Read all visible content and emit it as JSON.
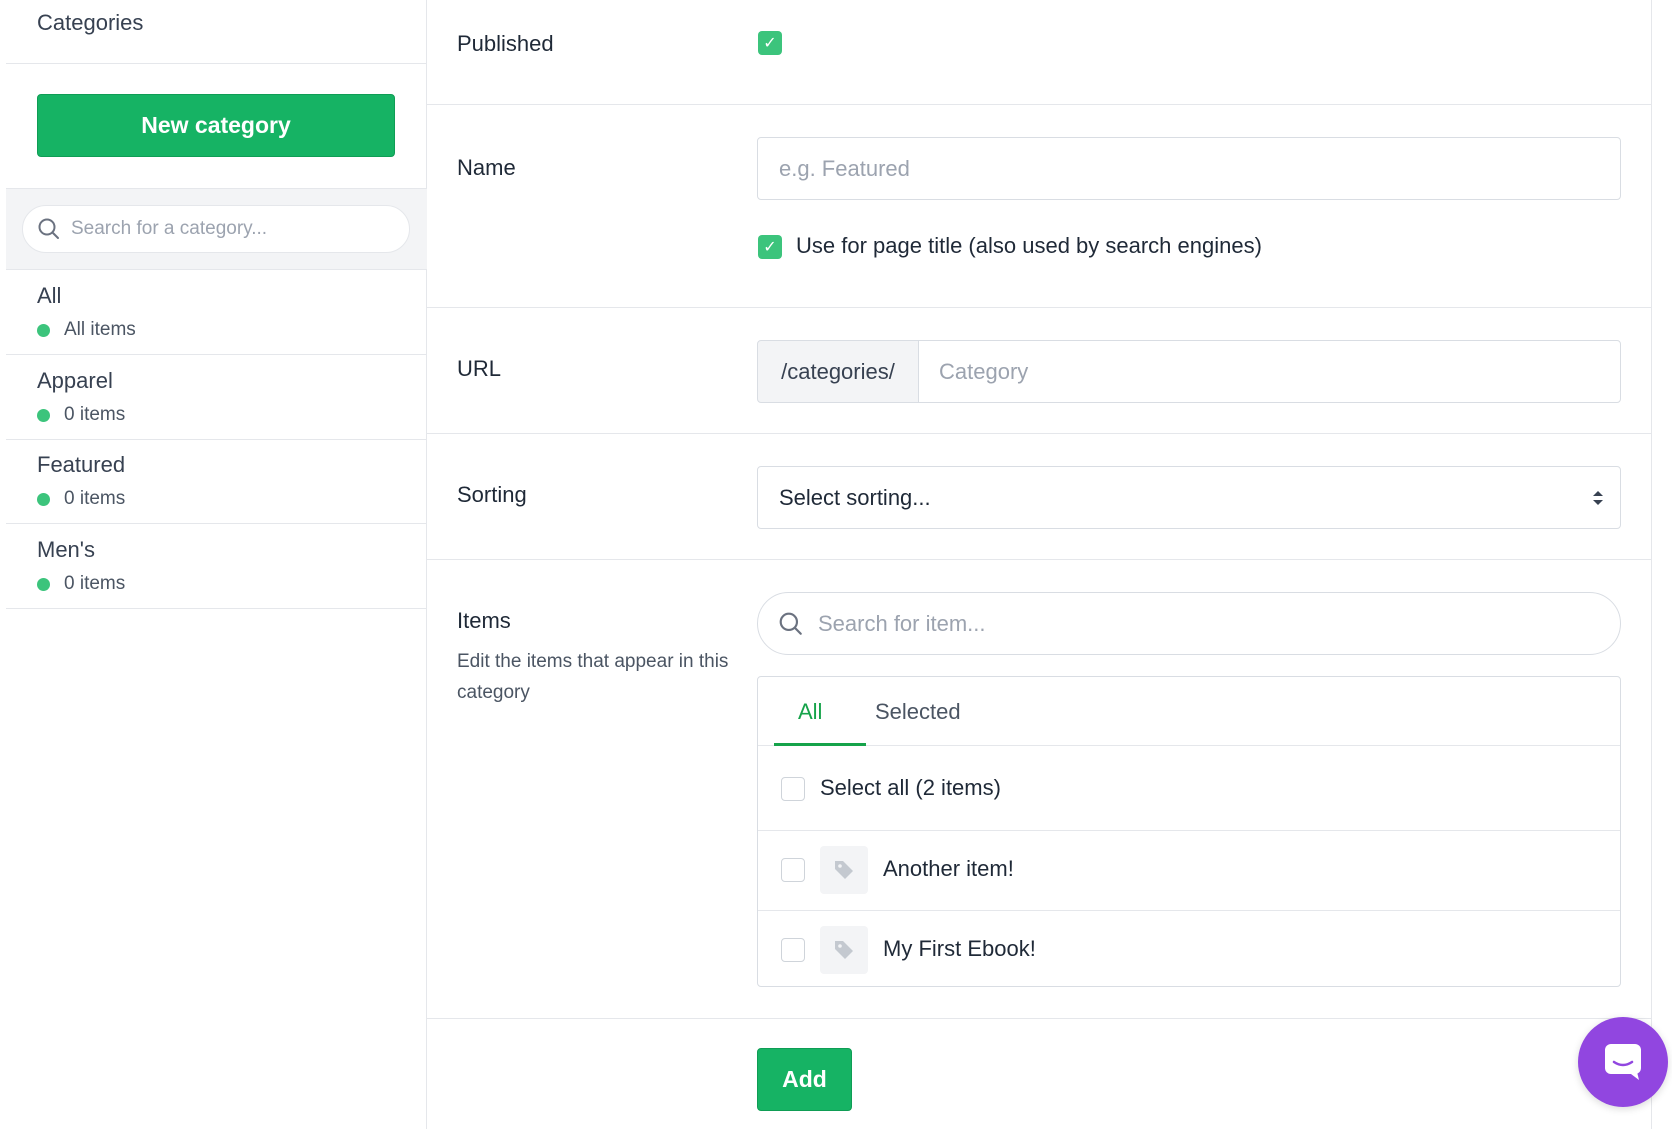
{
  "sidebar": {
    "title": "Categories",
    "new_category_label": "New category",
    "search_placeholder": "Search for a category...",
    "categories": [
      {
        "name": "All",
        "count": "All items"
      },
      {
        "name": "Apparel",
        "count": "0 items"
      },
      {
        "name": "Featured",
        "count": "0 items"
      },
      {
        "name": "Men's",
        "count": "0 items"
      }
    ]
  },
  "form": {
    "published_label": "Published",
    "published_checked": true,
    "name_label": "Name",
    "name_placeholder": "e.g. Featured",
    "page_title_checkbox_label": "Use for page title (also used by search engines)",
    "page_title_checked": true,
    "url_label": "URL",
    "url_prefix": "/categories/",
    "url_placeholder": "Category",
    "sorting_label": "Sorting",
    "sorting_value": "Select sorting...",
    "items_label": "Items",
    "items_description": "Edit the items that appear in this category",
    "item_search_placeholder": "Search for item...",
    "tabs": [
      {
        "label": "All",
        "active": true
      },
      {
        "label": "Selected",
        "active": false
      }
    ],
    "select_all_label": "Select all (2 items)",
    "items": [
      {
        "name": "Another item!",
        "icon": "tag-icon"
      },
      {
        "name": "My First Ebook!",
        "icon": "tag-icon"
      }
    ],
    "add_label": "Add"
  },
  "colors": {
    "accent_green": "#16b364",
    "status_green": "#3cc47c",
    "chat_purple": "#9146e0"
  }
}
